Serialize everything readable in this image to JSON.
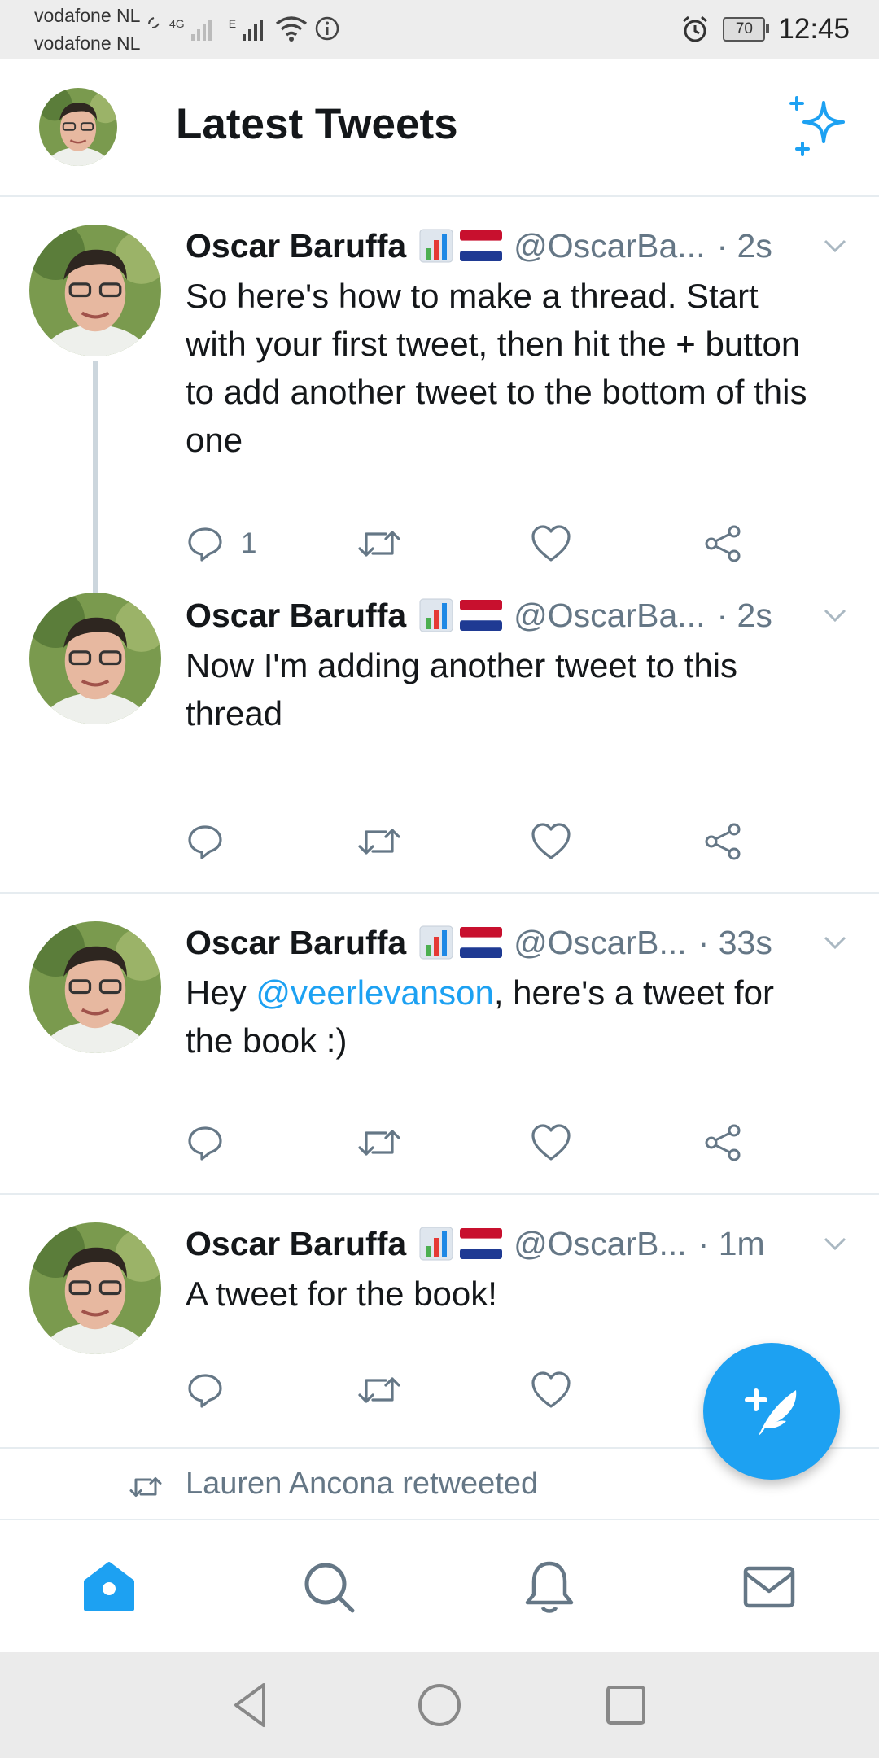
{
  "status_bar": {
    "carrier1": "vodafone NL",
    "carrier2": "vodafone NL",
    "network": "4G",
    "network2": "E",
    "battery": "70",
    "time": "12:45"
  },
  "header": {
    "title": "Latest Tweets"
  },
  "tweets": [
    {
      "name": "Oscar Baruffa",
      "handle": "@OscarBa...",
      "time": "· 2s",
      "text": "So here's how to make a thread. Start with your first tweet, then hit the + button to add another tweet to the bottom of this one",
      "reply_count": "1"
    },
    {
      "name": "Oscar Baruffa",
      "handle": "@OscarBa...",
      "time": "· 2s",
      "text": "Now I'm adding another tweet to this thread",
      "reply_count": ""
    },
    {
      "name": "Oscar Baruffa",
      "handle": "@OscarB...",
      "time": "· 33s",
      "text_before": "Hey ",
      "mention": "@veerlevanson",
      "text_after": ", here's a tweet for the book :)",
      "reply_count": ""
    },
    {
      "name": "Oscar Baruffa",
      "handle": "@OscarB...",
      "time": "· 1m",
      "text": "A tweet for the book!",
      "reply_count": ""
    }
  ],
  "retweet_notice": "Lauren Ancona retweeted",
  "colors": {
    "accent": "#1da1f2",
    "muted": "#657786",
    "text": "#14171a"
  },
  "icons": {
    "header": "sparkle-icon",
    "fab": "compose-tweet-icon",
    "nav": [
      "home-icon",
      "search-icon",
      "bell-icon",
      "mail-icon"
    ],
    "system_nav": [
      "back-icon",
      "home-circle-icon",
      "recents-icon"
    ]
  }
}
